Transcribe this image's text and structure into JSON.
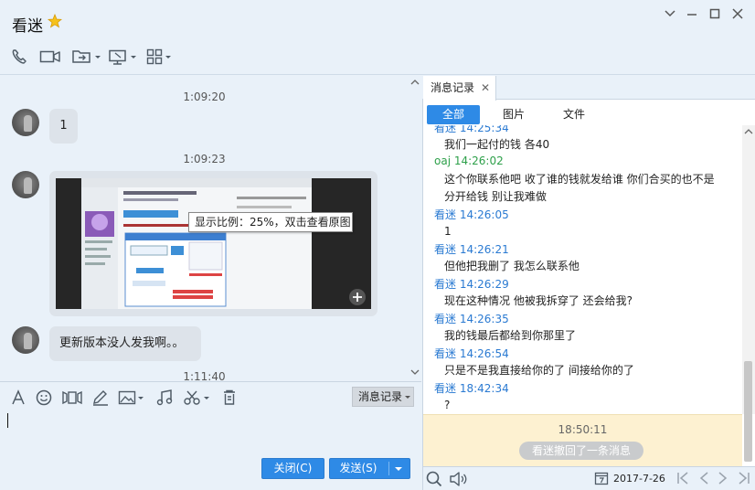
{
  "window": {
    "contact_name": "看迷",
    "star_icon": "star-icon",
    "controls": [
      "chevron-down-icon",
      "minimize-icon",
      "maximize-icon",
      "close-icon"
    ]
  },
  "toolbar": {
    "icons": [
      "phone-icon",
      "video-icon",
      "file-transfer-icon",
      "screen-share-icon",
      "apps-grid-icon"
    ]
  },
  "chat": {
    "messages": [
      {
        "time": "1:09:20",
        "type": "text",
        "text": "1"
      },
      {
        "time": "1:09:23",
        "type": "image",
        "image_tooltip": "显示比例：25%，双击查看原图"
      },
      {
        "type": "text",
        "text": "更新版本没人发我啊。。"
      },
      {
        "time": "1:11:40"
      }
    ]
  },
  "input": {
    "tool_icons": [
      "font-icon",
      "emoji-icon",
      "video-clip-icon",
      "pencil-icon",
      "image-icon",
      "music-icon",
      "scissors-icon",
      "trash-icon"
    ],
    "history_button": "消息记录",
    "close_button": "关闭(C)",
    "send_button": "发送(S)"
  },
  "history": {
    "tab_label": "消息记录",
    "filters": [
      "全部",
      "图片",
      "文件"
    ],
    "records": [
      {
        "sender": "看迷",
        "time": "14:25:34",
        "lines": [
          "我们一起付的钱 各40"
        ],
        "self": false
      },
      {
        "sender": "oaj",
        "time": "14:26:02",
        "lines": [
          "这个你联系他吧 收了谁的钱就发给谁 你们合买的也不是",
          "分开给钱 别让我难做"
        ],
        "self": true
      },
      {
        "sender": "看迷",
        "time": "14:26:05",
        "lines": [
          "1"
        ],
        "self": false
      },
      {
        "sender": "看迷",
        "time": "14:26:21",
        "lines": [
          "但他把我删了 我怎么联系他"
        ],
        "self": false
      },
      {
        "sender": "看迷",
        "time": "14:26:29",
        "lines": [
          " 现在这种情况 他被我拆穿了 还会给我?"
        ],
        "self": false
      },
      {
        "sender": "看迷",
        "time": "14:26:35",
        "lines": [
          "我的钱最后都给到你那里了"
        ],
        "self": false
      },
      {
        "sender": "看迷",
        "time": "14:26:54",
        "lines": [
          "只是不是我直接给你的了 间接给你的了"
        ],
        "self": false
      },
      {
        "sender": "看迷",
        "time": "18:42:34",
        "lines": [
          "?"
        ],
        "self": false
      }
    ],
    "recall_time": "18:50:11",
    "recall_message": "看迷撤回了一条消息",
    "date": "2017-7-26",
    "colors": {
      "other": "#2a7ad2",
      "self": "#2ea04a",
      "accent": "#2e8ae6"
    }
  }
}
